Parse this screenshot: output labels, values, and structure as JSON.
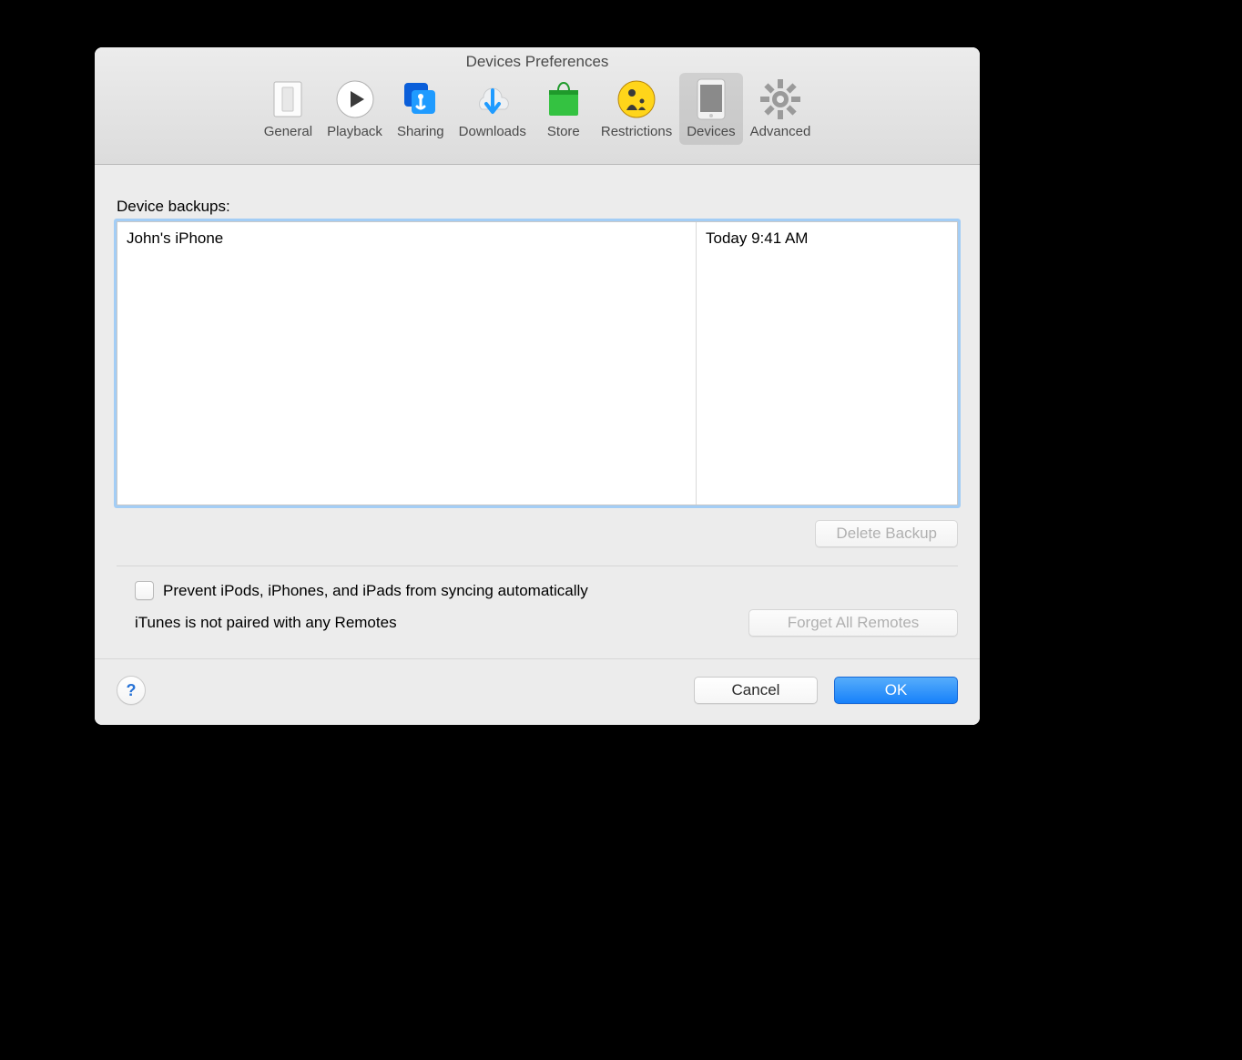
{
  "window": {
    "title": "Devices Preferences"
  },
  "toolbar": {
    "items": [
      {
        "id": "general",
        "label": "General"
      },
      {
        "id": "playback",
        "label": "Playback"
      },
      {
        "id": "sharing",
        "label": "Sharing"
      },
      {
        "id": "downloads",
        "label": "Downloads"
      },
      {
        "id": "store",
        "label": "Store"
      },
      {
        "id": "restrictions",
        "label": "Restrictions"
      },
      {
        "id": "devices",
        "label": "Devices"
      },
      {
        "id": "advanced",
        "label": "Advanced"
      }
    ],
    "selected": "devices"
  },
  "devices_pane": {
    "backups_label": "Device backups:",
    "backups": [
      {
        "name": "John's iPhone",
        "date": "Today 9:41 AM"
      }
    ],
    "delete_backup": "Delete Backup",
    "prevent_sync_label": "Prevent iPods, iPhones, and iPads from syncing automatically",
    "prevent_sync_checked": false,
    "remotes_status": "iTunes is not paired with any Remotes",
    "forget_remotes": "Forget All Remotes"
  },
  "footer": {
    "help": "?",
    "cancel": "Cancel",
    "ok": "OK"
  }
}
